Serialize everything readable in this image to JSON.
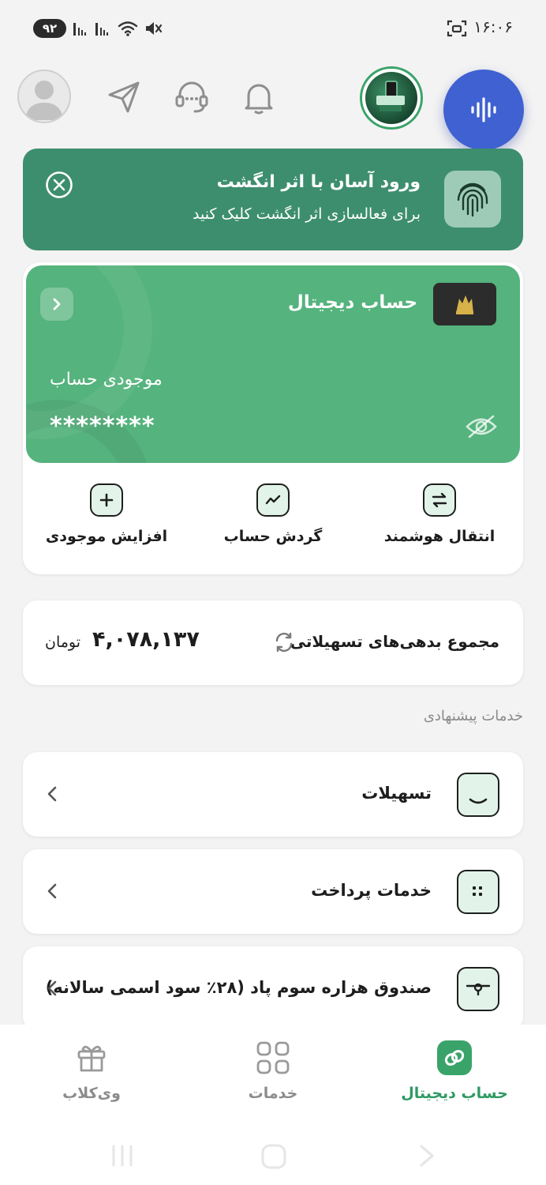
{
  "status_bar": {
    "battery": "۹۲",
    "time": "۱۶:۰۶"
  },
  "header": {
    "icons": [
      "avatar-icon",
      "send-icon",
      "support-headset-icon",
      "bell-icon",
      "story-icon",
      "voice-assistant-icon"
    ]
  },
  "fingerprint_banner": {
    "title": "ورود آسان با اثر انگشت",
    "subtitle": "برای فعالسازی اثر انگشت کلیک کنید"
  },
  "account_card": {
    "title": "حساب دیجیتال",
    "balance_label": "موجودی حساب",
    "balance_masked": "********"
  },
  "quick_actions": [
    {
      "label": "انتقال هوشمند",
      "icon": "transfer-icon"
    },
    {
      "label": "گردش حساب",
      "icon": "trend-icon"
    },
    {
      "label": "افزایش موجودی",
      "icon": "plus-icon"
    }
  ],
  "debt": {
    "label": "مجموع بدهی‌های تسهیلاتی",
    "amount": "۴,۰۷۸,۱۳۷",
    "unit": "تومان"
  },
  "suggested": {
    "title": "خدمات پیشنهادی",
    "items": [
      {
        "label": "تسهیلات",
        "icon": "loan-icon"
      },
      {
        "label": "خدمات پرداخت",
        "icon": "receipt-icon"
      },
      {
        "label": "صندوق هزاره سوم پاد (۲۸٪ سود اسمی سالانه)",
        "icon": "chest-icon"
      }
    ]
  },
  "bottom_nav": [
    {
      "label": "حساب دیجیتال",
      "active": true
    },
    {
      "label": "خدمات",
      "active": false
    },
    {
      "label": "وی‌کلاب",
      "active": false
    }
  ],
  "colors": {
    "primary_green": "#55b37d",
    "banner_green": "#3d8e6f",
    "voice_blue": "#3f61d1",
    "active_nav": "#2f9a63"
  }
}
